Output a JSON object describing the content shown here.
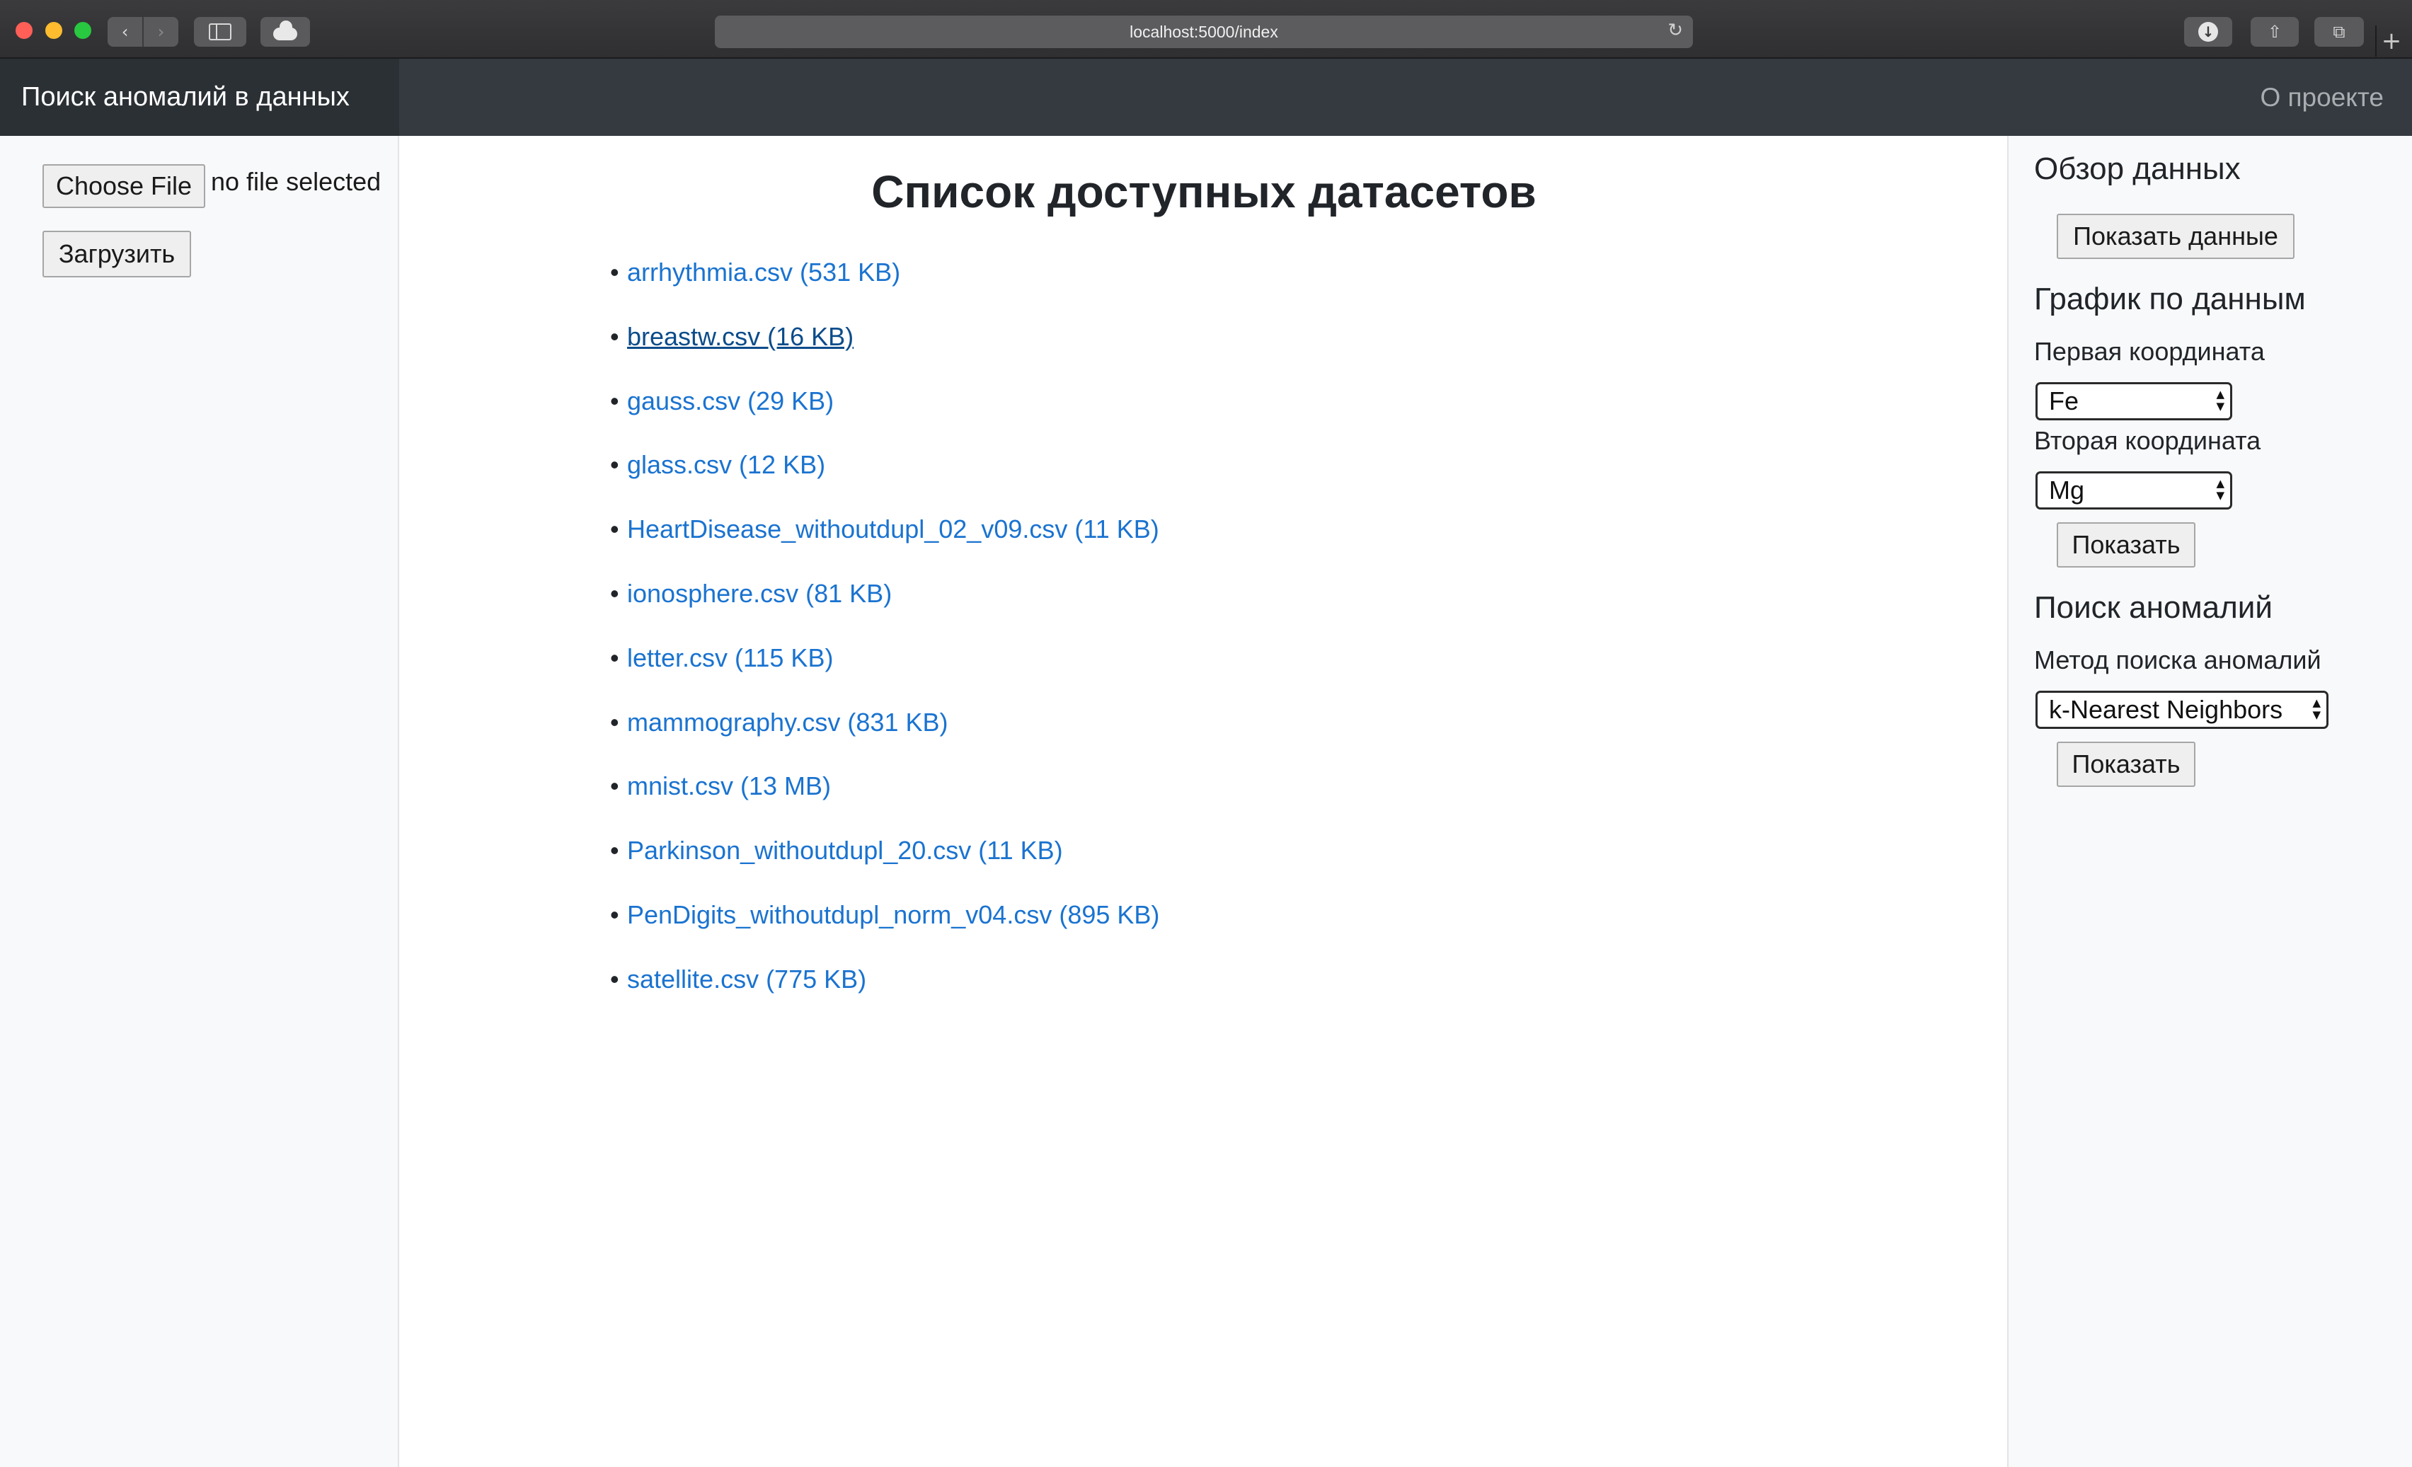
{
  "browser": {
    "url": "localhost:5000/index"
  },
  "navbar": {
    "brand": "Поиск аномалий в данных",
    "about": "О проекте"
  },
  "left_panel": {
    "choose_file_label": "Choose File",
    "no_file_text": "no file selected",
    "upload_label": "Загрузить"
  },
  "main": {
    "title": "Список доступных датасетов",
    "datasets": [
      {
        "label": "arrhythmia.csv (531 KB)"
      },
      {
        "label": "breastw.csv (16 KB)",
        "active": true
      },
      {
        "label": "gauss.csv (29 KB)"
      },
      {
        "label": "glass.csv (12 KB)"
      },
      {
        "label": "HeartDisease_withoutdupl_02_v09.csv (11 KB)"
      },
      {
        "label": "ionosphere.csv (81 KB)"
      },
      {
        "label": "letter.csv (115 KB)"
      },
      {
        "label": "mammography.csv (831 KB)"
      },
      {
        "label": "mnist.csv (13 MB)"
      },
      {
        "label": "Parkinson_withoutdupl_20.csv (11 KB)"
      },
      {
        "label": "PenDigits_withoutdupl_norm_v04.csv (895 KB)"
      },
      {
        "label": "satellite.csv (775 KB)"
      }
    ]
  },
  "right_panel": {
    "overview": {
      "heading": "Обзор данных",
      "show_data_label": "Показать данные"
    },
    "plot": {
      "heading": "График по данным",
      "first_coord_label": "Первая координата",
      "first_coord_value": "Fe",
      "second_coord_label": "Вторая координата",
      "second_coord_value": "Mg",
      "show_label": "Показать"
    },
    "anomaly": {
      "heading": "Поиск аномалий",
      "method_label": "Метод поиска аномалий",
      "method_value": "k-Nearest Neighbors",
      "show_label": "Показать"
    }
  }
}
